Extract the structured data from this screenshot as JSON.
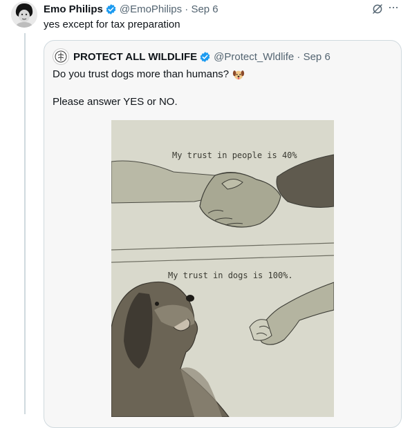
{
  "tweet": {
    "author_name": "Emo Philips",
    "handle_date": "@EmoPhilips · Sep 6",
    "text": "yes except for tax preparation",
    "more_label": "···"
  },
  "quote": {
    "author_name": "PROTECT ALL WILDLIFE",
    "handle_date": "@Protect_Wldlife · Sep 6",
    "line1": "Do you trust dogs more than humans?",
    "line2": "Please answer YES or NO."
  },
  "image": {
    "caption_top": "My trust in people is 40%",
    "caption_bottom": "My trust in dogs is 100%."
  },
  "icons": {
    "verified": "verified-badge-icon",
    "grok": "grok-icon",
    "more": "more-dots-icon",
    "dog_emoji": "dog-face-emoji-icon",
    "wildlife_logo": "wildlife-logo-icon"
  },
  "colors": {
    "verified_blue": "#1d9bf0",
    "muted_text": "#536471",
    "thread_line": "#cfd9de"
  }
}
